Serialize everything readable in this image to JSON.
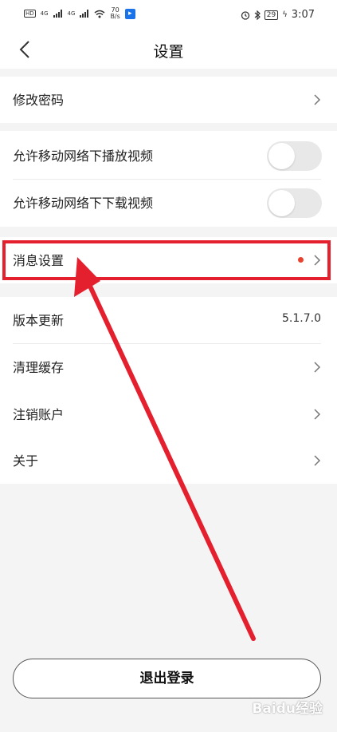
{
  "status_bar": {
    "hd1": "HD",
    "hd2": "HD",
    "signal1": "4G",
    "signal2": "4G",
    "speed_value": "70",
    "speed_unit": "B/s",
    "battery": "29",
    "time": "3:07"
  },
  "nav": {
    "title": "设置"
  },
  "rows": {
    "change_password": "修改密码",
    "mobile_play": "允许移动网络下播放视频",
    "mobile_download": "允许移动网络下下载视频",
    "message_settings": "消息设置",
    "version": "版本更新",
    "version_value": "5.1.7.0",
    "clear_cache": "清理缓存",
    "delete_account": "注销账户",
    "about": "关于"
  },
  "toggles": {
    "mobile_play_on": false,
    "mobile_download_on": false
  },
  "logout": {
    "label": "退出登录"
  },
  "watermark": "Baidu经验",
  "colors": {
    "accent_red": "#e5202e",
    "dot_red": "#e8412f",
    "background": "#f4f4f4"
  }
}
